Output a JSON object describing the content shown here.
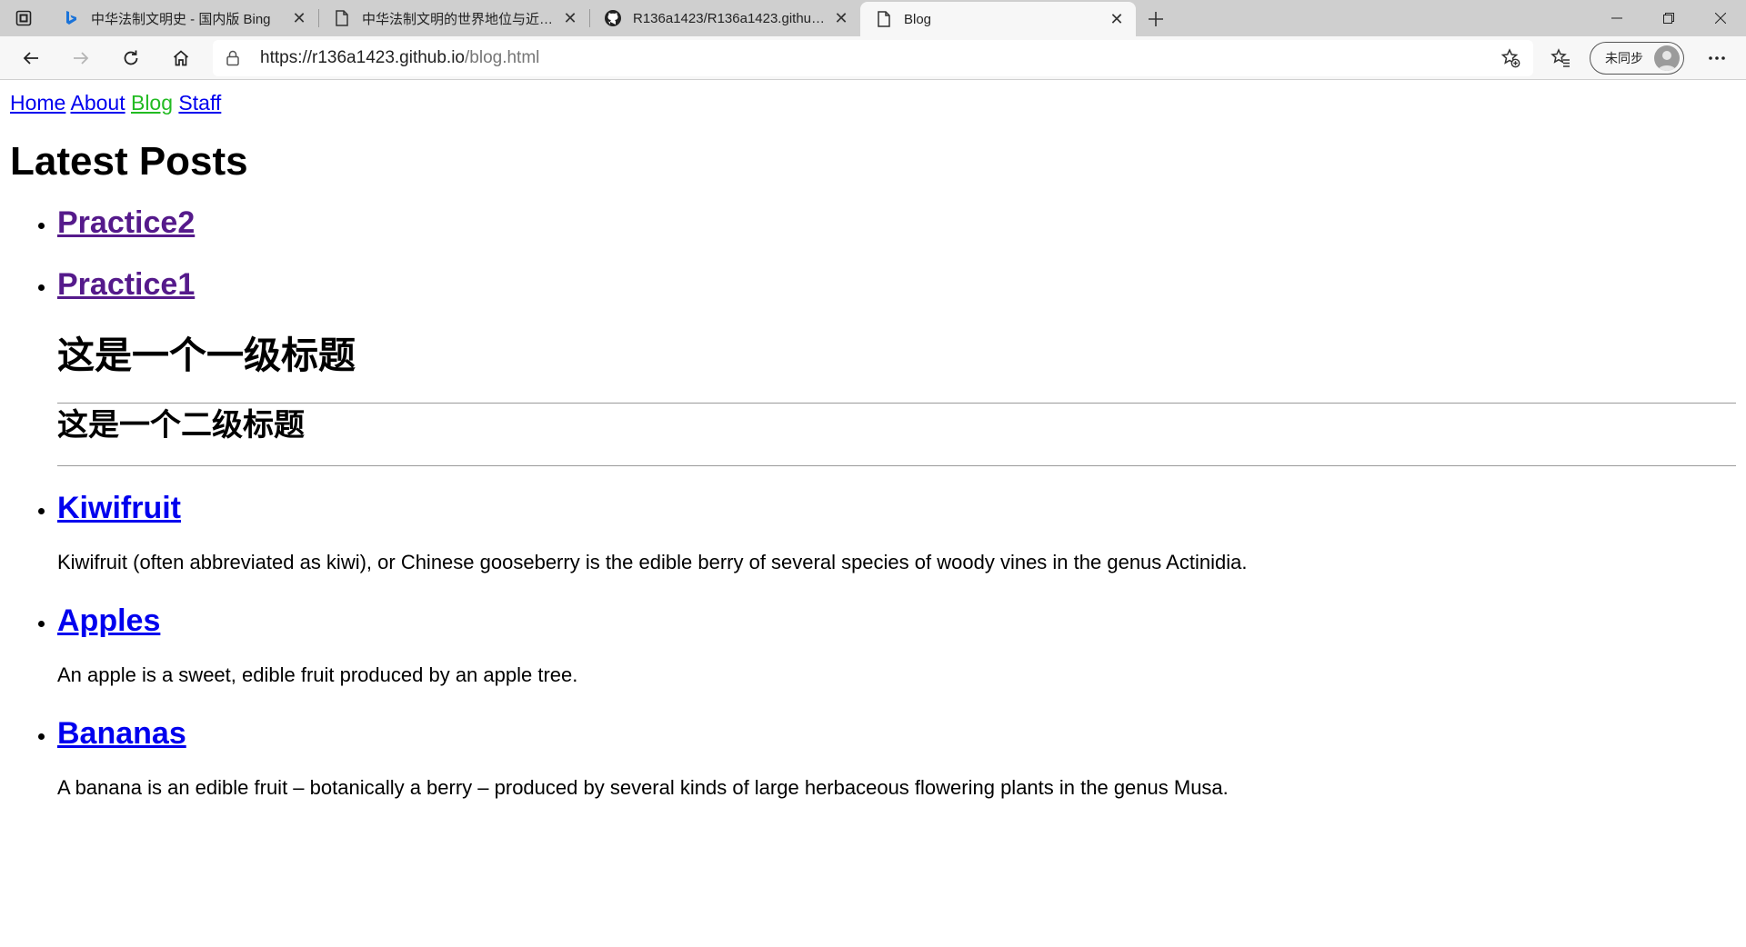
{
  "tabs": [
    {
      "title": "中华法制文明史 - 国内版 Bing",
      "icon": "bing-icon"
    },
    {
      "title": "中华法制文明的世界地位与近代化",
      "icon": "page-icon"
    },
    {
      "title": "R136a1423/R136a1423.github.io",
      "icon": "github-icon"
    },
    {
      "title": "Blog",
      "icon": "page-icon",
      "active": true
    }
  ],
  "address": {
    "host": "https://r136a1423.github.io",
    "path": "/blog.html"
  },
  "profile": {
    "label": "未同步"
  },
  "nav": [
    {
      "label": "Home"
    },
    {
      "label": "About"
    },
    {
      "label": "Blog",
      "current": true
    },
    {
      "label": "Staff"
    }
  ],
  "heading": "Latest Posts",
  "posts": [
    {
      "title": "Practice2"
    },
    {
      "title": "Practice1",
      "h1": "这是一个一级标题",
      "h2": "这是一个二级标题"
    },
    {
      "title": "Kiwifruit",
      "desc": "Kiwifruit (often abbreviated as kiwi), or Chinese gooseberry is the edible berry of several species of woody vines in the genus Actinidia."
    },
    {
      "title": "Apples",
      "desc": "An apple is a sweet, edible fruit produced by an apple tree."
    },
    {
      "title": "Bananas",
      "desc": "A banana is an edible fruit – botanically a berry – produced by several kinds of large herbaceous flowering plants in the genus Musa."
    }
  ],
  "colors": {
    "visited_link": "#551a8b",
    "link": "#0000ee",
    "current_nav": "#22bb22"
  }
}
